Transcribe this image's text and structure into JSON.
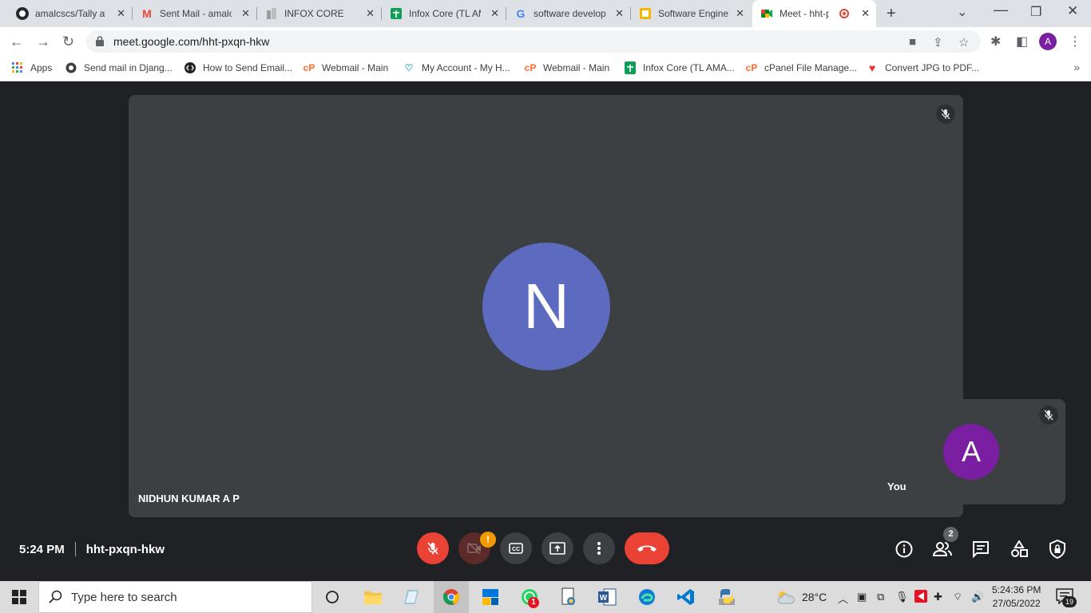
{
  "browser": {
    "tabs": [
      {
        "title": "amalcscs/Tally at",
        "icon": "github-icon"
      },
      {
        "title": "Sent Mail - amalc",
        "icon": "gmail-icon"
      },
      {
        "title": "INFOX CORE",
        "icon": "document-icon"
      },
      {
        "title": "Infox Core (TL AM",
        "icon": "sheets-icon"
      },
      {
        "title": "software develop",
        "icon": "google-icon"
      },
      {
        "title": "Software Enginee",
        "icon": "doc-icon"
      },
      {
        "title": "Meet - hht-p",
        "icon": "meet-icon",
        "active": true
      }
    ],
    "url": "meet.google.com/hht-pxqn-hkw",
    "profile_initial": "A",
    "bookmarks": [
      {
        "label": "Apps",
        "icon": "apps-grid-icon"
      },
      {
        "label": "Send mail in Djang...",
        "icon": "globe-icon"
      },
      {
        "label": "How to Send Email...",
        "icon": "code-icon"
      },
      {
        "label": "Webmail - Main",
        "icon": "cpanel-icon"
      },
      {
        "label": "My Account - My H...",
        "icon": "hosting-icon"
      },
      {
        "label": "Webmail - Main",
        "icon": "cpanel-icon"
      },
      {
        "label": "Infox Core (TL AMA...",
        "icon": "sheets-icon"
      },
      {
        "label": "cPanel File Manage...",
        "icon": "cpanel-icon"
      },
      {
        "label": "Convert JPG to PDF...",
        "icon": "heart-icon"
      }
    ]
  },
  "meet": {
    "main_participant": {
      "name": "NIDHUN KUMAR A P",
      "initial": "N",
      "color": "#5c6bc0"
    },
    "self": {
      "name": "You",
      "initial": "A",
      "color": "#7b1fa2"
    },
    "time": "5:24 PM",
    "meeting_code": "hht-pxqn-hkw",
    "camera_warning": "!",
    "people_count": "2"
  },
  "taskbar": {
    "search_placeholder": "Type here to search",
    "weather": "28°C",
    "time": "5:24:36 PM",
    "date": "27/05/2022",
    "notifications": "19",
    "whatsapp_badge": "1"
  }
}
